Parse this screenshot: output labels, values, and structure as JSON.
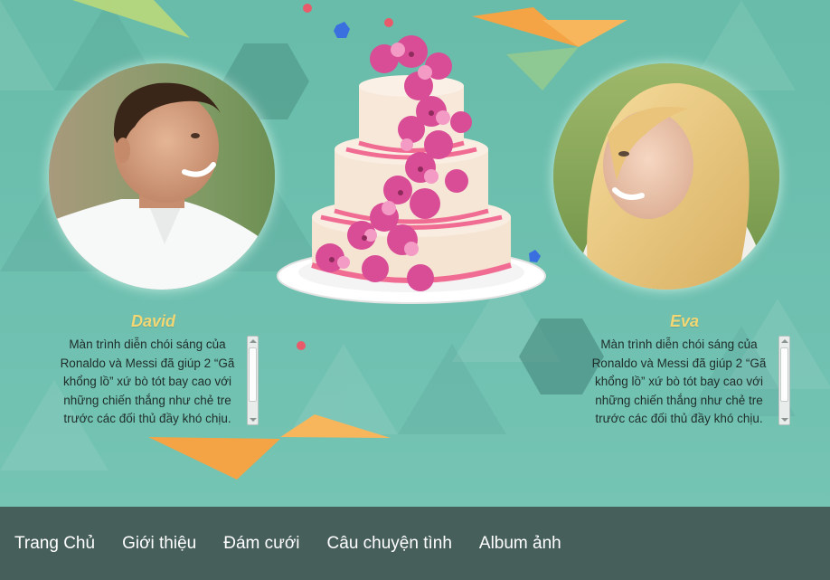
{
  "couple": {
    "groom": {
      "name": "David",
      "bio": "Màn trình diễn chói sáng của Ronaldo và Messi đã giúp 2 “Gã khổng lồ” xứ bò tót bay cao với những chiến thắng như chẻ tre trước các đối thủ đầy khó chịu."
    },
    "bride": {
      "name": "Eva",
      "bio": "Màn trình diễn chói sáng của Ronaldo và Messi đã giúp 2 “Gã khổng lồ” xứ bò tót bay cao với những chiến thắng như chẻ tre trước các đối thủ đầy khó chịu."
    }
  },
  "nav": {
    "items": [
      "Trang Chủ",
      "Giới thiệu",
      "Đám cưới",
      "Câu chuyện tình",
      "Album ảnh"
    ]
  },
  "colors": {
    "background": "#6dbdad",
    "accent_orange": "#f5a445",
    "name_gold": "#f2d774",
    "nav_bg": "#465f5b"
  },
  "images": {
    "groom_photo": "smiling-man-portrait",
    "bride_photo": "smiling-blonde-woman-portrait",
    "cake": "three-tier-wedding-cake-with-pink-orchids"
  }
}
